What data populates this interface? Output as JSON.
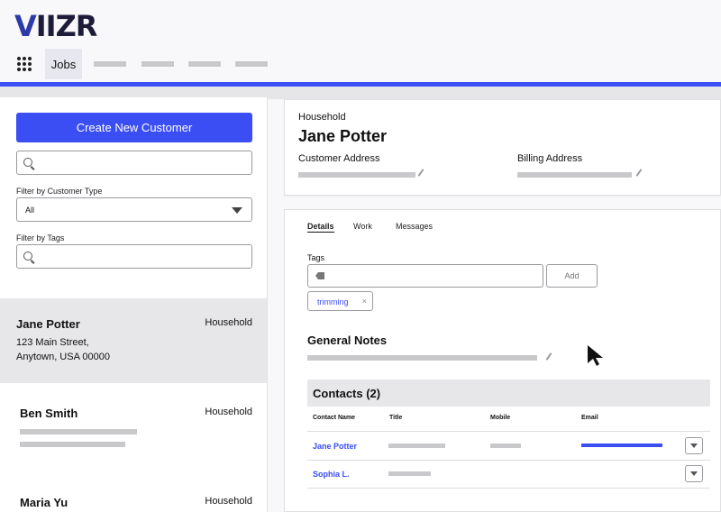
{
  "app": {
    "logo": "VIIZR",
    "nav": {
      "active_tab": "Jobs"
    },
    "accent_color": "#3a4ef3"
  },
  "sidebar": {
    "create_button": "Create New Customer",
    "search_placeholder": "",
    "filter_type_label": "Filter by Customer Type",
    "filter_type_value": "All",
    "filter_tags_label": "Filter by Tags",
    "customers": [
      {
        "name": "Jane Potter",
        "type": "Household",
        "address_line1": "123 Main Street,",
        "address_line2": "Anytown, USA 00000"
      },
      {
        "name": "Ben Smith",
        "type": "Household"
      },
      {
        "name": "Maria Yu",
        "type": "Household"
      }
    ]
  },
  "customer": {
    "type": "Household",
    "name": "Jane Potter",
    "customer_address_label": "Customer Address",
    "billing_address_label": "Billing Address"
  },
  "details": {
    "tabs": [
      "Details",
      "Work",
      "Messages"
    ],
    "tags_label": "Tags",
    "add_button": "Add",
    "tags": [
      {
        "label": "trimming",
        "remove": "×"
      }
    ],
    "general_notes_title": "General Notes",
    "contacts_title": "Contacts (2)",
    "contact_columns": [
      "Contact Name",
      "Title",
      "Mobile",
      "Email"
    ],
    "contacts": [
      {
        "name": "Jane Potter"
      },
      {
        "name": "Sophia L."
      }
    ]
  }
}
